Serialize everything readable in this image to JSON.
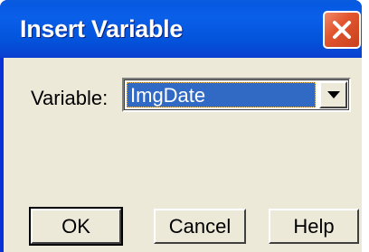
{
  "window": {
    "title": "Insert Variable",
    "icons": {
      "close": "close-icon"
    },
    "colors": {
      "titlebar": "#0a5fe8",
      "client": "#ece9d8",
      "close_button": "#e2562f",
      "selection": "#316ac5"
    }
  },
  "form": {
    "variable_label": "Variable:",
    "variable_value": "ImgDate",
    "dropdown_icon": "chevron-down-icon"
  },
  "buttons": {
    "ok": "OK",
    "cancel": "Cancel",
    "help": "Help"
  }
}
